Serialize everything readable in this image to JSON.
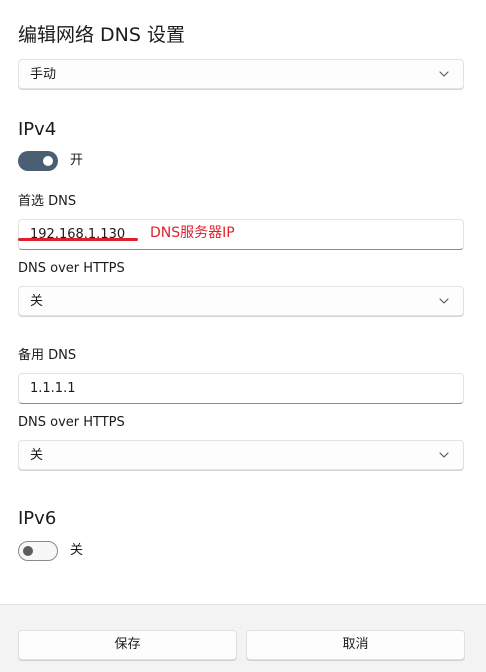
{
  "dialog": {
    "title": "编辑网络 DNS 设置"
  },
  "mode_select": {
    "value": "手动"
  },
  "ipv4": {
    "title": "IPv4",
    "toggle_state": "开",
    "preferred_dns": {
      "label": "首选 DNS",
      "value": "192.168.1.130",
      "annotation": "DNS服务器IP"
    },
    "preferred_doh": {
      "label": "DNS over HTTPS",
      "value": "关"
    },
    "alternate_dns": {
      "label": "备用 DNS",
      "value": "1.1.1.1"
    },
    "alternate_doh": {
      "label": "DNS over HTTPS",
      "value": "关"
    }
  },
  "ipv6": {
    "title": "IPv6",
    "toggle_state": "关"
  },
  "footer": {
    "save_label": "保存",
    "cancel_label": "取消"
  },
  "colors": {
    "accent_toggle": "#4b5f72",
    "annotation_red": "#e0212b",
    "footer_bg": "#f3f3f3"
  }
}
